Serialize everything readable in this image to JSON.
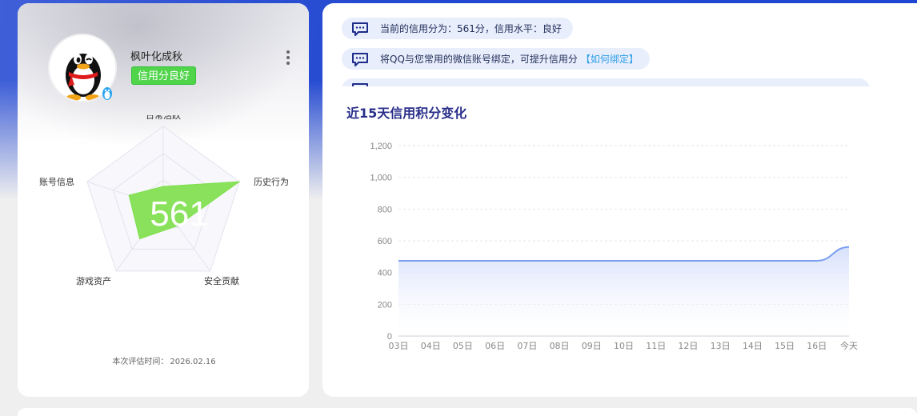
{
  "profile": {
    "nickname": "枫叶化成秋",
    "credit_tag": "信用分良好",
    "avatar_icon": "qq-penguin-avatar",
    "badge_icon": "qq-penguin-badge"
  },
  "radar": {
    "score": "561",
    "dimensions": [
      "日常活跃",
      "历史行为",
      "安全贡献",
      "游戏资产",
      "账号信息"
    ],
    "values": [
      0.25,
      1.0,
      0.3,
      0.5,
      0.45
    ],
    "fill_color": "#7ddf4a"
  },
  "evaluation": {
    "label": "本次评估时间：",
    "date": "2026.02.16"
  },
  "notices": [
    {
      "text": "当前的信用分为：561分，信用水平：良好",
      "link": ""
    },
    {
      "text": "将QQ与您常用的微信账号绑定，可提升信用分",
      "link": "【如何绑定】"
    }
  ],
  "chart_title": "近15天信用积分变化",
  "chart_data": {
    "type": "area",
    "categories": [
      "03日",
      "04日",
      "05日",
      "06日",
      "07日",
      "08日",
      "09日",
      "10日",
      "11日",
      "12日",
      "13日",
      "14日",
      "15日",
      "16日",
      "今天"
    ],
    "values": [
      474,
      474,
      474,
      474,
      474,
      474,
      474,
      474,
      474,
      474,
      474,
      474,
      474,
      474,
      561
    ],
    "ylim": [
      0,
      1200
    ],
    "yticks": [
      "0",
      "200",
      "400",
      "600",
      "800",
      "1,000",
      "1,200"
    ],
    "grid": true,
    "line_color": "#7b9ef0",
    "fill_top_color": "#d6e0fb"
  }
}
